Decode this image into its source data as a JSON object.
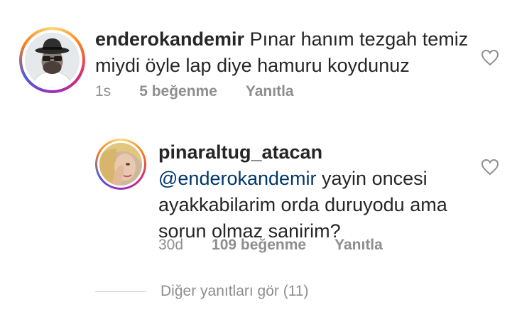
{
  "comments": [
    {
      "username": "enderokandemir",
      "text_line1": "Pınar hanım tezgah temiz",
      "text_line2": "miydi öyle lap diye hamuru koydunuz",
      "time": "1s",
      "likes": "5 beğenme",
      "reply": "Yanıtla"
    },
    {
      "username": "pinaraltug_atacan",
      "mention": "@enderokandemir",
      "text_line1": " yayin oncesi",
      "text_line2": "ayakkabilarim orda duruyodu ama",
      "text_line3": "sorun olmaz sanirim?",
      "time": "30d",
      "likes": "109 beğenme",
      "reply": "Yanıtla"
    }
  ],
  "view_replies": "Diğer yanıtları gör (11)",
  "colors": {
    "text": "#262626",
    "secondary": "#8e8e8e",
    "mention": "#00376b",
    "divider": "#c7c7c7"
  },
  "icons": [
    "heart-outline-icon"
  ]
}
